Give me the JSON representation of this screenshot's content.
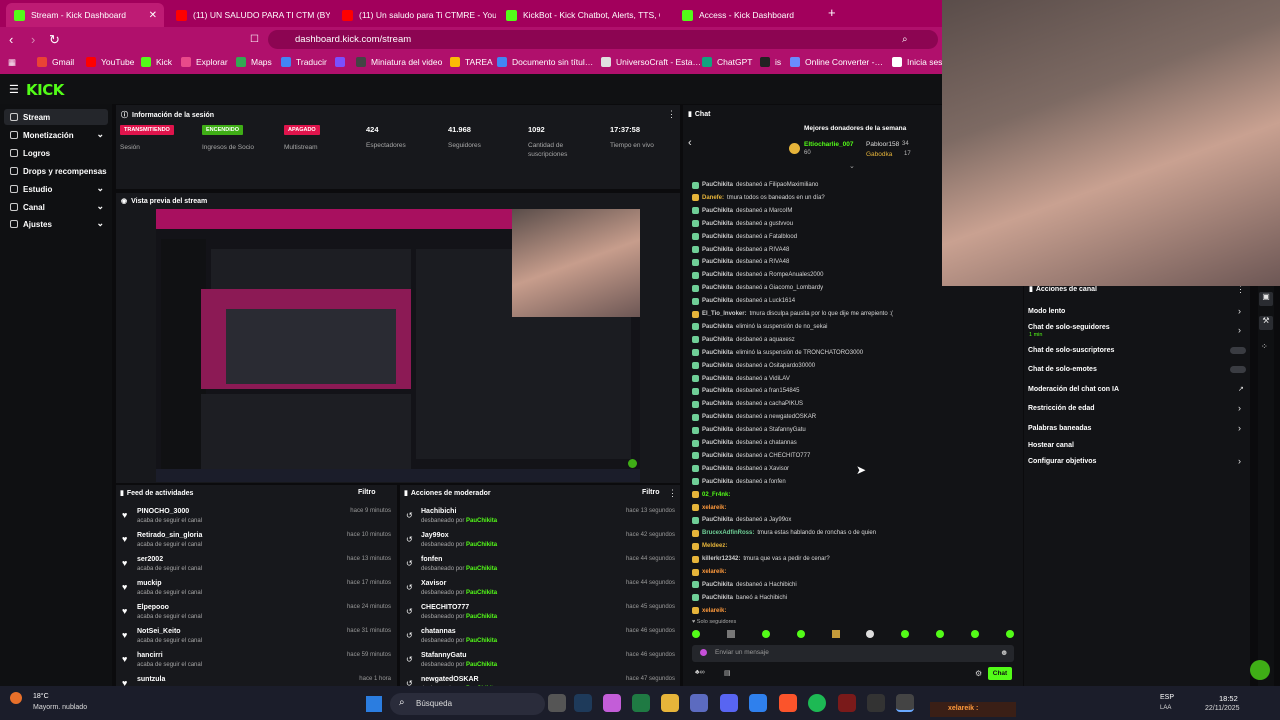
{
  "browser": {
    "tabs": [
      {
        "title": "Stream - Kick Dashboard",
        "icon": "kick-icon",
        "color": "#53fc18"
      },
      {
        "title": "(11) UN SALUDO PARA TI CTM (BY P…",
        "icon": "youtube-icon",
        "color": "#ff0000"
      },
      {
        "title": "(11) Un saludo para Ti CTMRE - YouT…",
        "icon": "youtube-icon",
        "color": "#ff0000"
      },
      {
        "title": "KickBot - Kick Chatbot, Alerts, TTS, C…",
        "icon": "kickbot-icon",
        "color": "#53fc18"
      },
      {
        "title": "Access - Kick Dashboard",
        "icon": "kick-icon",
        "color": "#53fc18"
      }
    ],
    "url": "dashboard.kick.com/stream",
    "bookmarks": [
      "Gmail",
      "YouTube",
      "Kick",
      "Explorar",
      "Maps",
      "Traducir",
      "",
      "Miniatura del video",
      "TAREA",
      "Documento sin títul…",
      "UniversoCraft - Esta…",
      "ChatGPT",
      "is",
      "Online Converter -…",
      "Inicia sesi"
    ]
  },
  "sidebar": {
    "items": [
      {
        "label": "Stream",
        "chev": ""
      },
      {
        "label": "Monetización",
        "chev": "⌄"
      },
      {
        "label": "Logros",
        "chev": ""
      },
      {
        "label": "Drops y recompensas",
        "chev": ""
      },
      {
        "label": "Estudio",
        "chev": "⌄"
      },
      {
        "label": "Canal",
        "chev": "⌄"
      },
      {
        "label": "Ajustes",
        "chev": "⌄"
      }
    ]
  },
  "session": {
    "title": "Información de la sesión",
    "stats": [
      {
        "badge": "TRANSMITIENDO",
        "badge_color": "#e0144c",
        "label": "Sesión"
      },
      {
        "badge": "ENCENDIDO",
        "badge_color": "#3fae16",
        "label": "Ingresos de Socio"
      },
      {
        "badge": "APAGADO",
        "badge_color": "#e0144c",
        "label": "Multistream"
      },
      {
        "value": "424",
        "label": "Espectadores"
      },
      {
        "value": "41.968",
        "label": "Seguidores"
      },
      {
        "value": "1092",
        "label": "Cantidad de suscripciones"
      },
      {
        "value": "17:37:58",
        "label": "Tiempo en vivo"
      }
    ]
  },
  "preview": {
    "title": "Vista previa del stream"
  },
  "activity": {
    "title": "Feed de actividades",
    "filter": "Filtro",
    "items": [
      {
        "name": "PINOCHO_3000",
        "sub": "acaba de seguir el canal",
        "time": "hace 9 minutos"
      },
      {
        "name": "Retirado_sin_gloria",
        "sub": "acaba de seguir el canal",
        "time": "hace 10 minutos"
      },
      {
        "name": "ser2002",
        "sub": "acaba de seguir el canal",
        "time": "hace 13 minutos"
      },
      {
        "name": "muckip",
        "sub": "acaba de seguir el canal",
        "time": "hace 17 minutos"
      },
      {
        "name": "Elpepooo",
        "sub": "acaba de seguir el canal",
        "time": "hace 24 minutos"
      },
      {
        "name": "NotSei_Keito",
        "sub": "acaba de seguir el canal",
        "time": "hace 31 minutos"
      },
      {
        "name": "hancirri",
        "sub": "acaba de seguir el canal",
        "time": "hace 59 minutos"
      },
      {
        "name": "suntzula",
        "sub": "",
        "time": "hace 1 hora"
      }
    ]
  },
  "modactions": {
    "title": "Acciones de moderador",
    "filter": "Filtro",
    "items": [
      {
        "name": "Hachibichi",
        "time": "hace 13 segundos"
      },
      {
        "name": "Jay99ox",
        "time": "hace 42 segundos"
      },
      {
        "name": "fonfen",
        "time": "hace 44 segundos"
      },
      {
        "name": "Xavisor",
        "time": "hace 44 segundos"
      },
      {
        "name": "CHECHITO777",
        "time": "hace 45 segundos"
      },
      {
        "name": "chatannas",
        "time": "hace 46 segundos"
      },
      {
        "name": "StafannyGatu",
        "time": "hace 46 segundos"
      },
      {
        "name": "newgatedOSKAR",
        "time": "hace 47 segundos"
      }
    ],
    "sub_prefix": "desbaneado por",
    "moderator": "PauChikita"
  },
  "chat": {
    "title": "Chat",
    "donors_title": "Mejores donadores de la semana",
    "donors": [
      {
        "name": "Eltiocharlie_007",
        "amount": "60"
      },
      {
        "name": "Pabloor158",
        "amount": "34"
      },
      {
        "name": "Gabodka",
        "amount": "17"
      }
    ],
    "lines": [
      {
        "user": "PauChikita",
        "text": "desbaneó a FilipaoMaximiliano"
      },
      {
        "user": "Danefe:",
        "text": "tmura todos os baneados en un día?"
      },
      {
        "user": "PauChikita",
        "text": "desbaneó a MarcoIM"
      },
      {
        "user": "PauChikita",
        "text": "desbaneó a gustvvou"
      },
      {
        "user": "PauChikita",
        "text": "desbaneó a Fatalblood"
      },
      {
        "user": "PauChikita",
        "text": "desbaneó a RIVA48"
      },
      {
        "user": "PauChikita",
        "text": "desbaneó a RIVA48"
      },
      {
        "user": "PauChikita",
        "text": "desbaneó a RompeAnuales2000"
      },
      {
        "user": "PauChikita",
        "text": "desbaneó a Giacomo_Lombardy"
      },
      {
        "user": "PauChikita",
        "text": "desbaneó a Luck1614"
      },
      {
        "user": "El_Tio_Invoker:",
        "text": "tmura disculpa pausita por lo que dije me arrepiento :("
      },
      {
        "user": "PauChikita",
        "text": "eliminó la suspensión de no_sekai"
      },
      {
        "user": "PauChikita",
        "text": "desbaneó a aquaxesz"
      },
      {
        "user": "PauChikita",
        "text": "eliminó la suspensión de TRONCHATORO3000"
      },
      {
        "user": "PauChikita",
        "text": "desbaneó a Ositapardo30000"
      },
      {
        "user": "PauChikita",
        "text": "desbaneó a VidiLAV"
      },
      {
        "user": "PauChikita",
        "text": "desbaneó a fran154845"
      },
      {
        "user": "PauChikita",
        "text": "desbaneó a cachaPIKUS"
      },
      {
        "user": "PauChikita",
        "text": "desbaneó a newgatedOSKAR"
      },
      {
        "user": "PauChikita",
        "text": "desbaneó a StafannyGatu"
      },
      {
        "user": "PauChikita",
        "text": "desbaneó a chatannas"
      },
      {
        "user": "PauChikita",
        "text": "desbaneó a CHECHITO777"
      },
      {
        "user": "PauChikita",
        "text": "desbaneó a Xavisor"
      },
      {
        "user": "PauChikita",
        "text": "desbaneó a fonfen"
      },
      {
        "user": "02_Fr4nk:",
        "text": ""
      },
      {
        "user": "xelareik:",
        "text": ""
      },
      {
        "user": "PauChikita",
        "text": "desbaneó a Jay99ox"
      },
      {
        "user": "BrucexAdfinRoss:",
        "text": "tmura estas hablando de ronchas o de quien"
      },
      {
        "user": "Meldeez:",
        "text": ""
      },
      {
        "user": "killerkr12342:",
        "text": "tmura       que vas a pedir de cenar?"
      },
      {
        "user": "xelareik:",
        "text": ""
      },
      {
        "user": "PauChikita",
        "text": "desbaneó a Hachibichi"
      },
      {
        "user": "PauChikita",
        "text": "baneó a Hachibichi"
      },
      {
        "user": "xelareik:",
        "text": ""
      }
    ],
    "followers_only": "Solo seguidores",
    "input_placeholder": "Enviar un mensaje",
    "send_label": "Chat"
  },
  "channel_actions": {
    "title": "Acciones de canal",
    "items": [
      {
        "label": "Modo lento",
        "control": "chevron"
      },
      {
        "label": "Chat de solo-seguidores",
        "sub": "1 min",
        "control": "chevron"
      },
      {
        "label": "Chat de solo-suscriptores",
        "control": "toggle"
      },
      {
        "label": "Chat de solo-emotes",
        "control": "toggle"
      },
      {
        "label": "Moderación del chat con IA",
        "control": "external"
      },
      {
        "label": "Restricción de edad",
        "control": "chevron"
      },
      {
        "label": "Palabras baneadas",
        "control": "chevron"
      },
      {
        "label": "Hostear canal",
        "control": "none"
      },
      {
        "label": "Configurar objetivos",
        "control": "chevron"
      }
    ]
  },
  "taskbar": {
    "weather_temp": "18°C",
    "weather_desc": "Mayorm. nublado",
    "search": "Búsqueda",
    "lang": "ESP",
    "lang_sub": "LAA",
    "time": "18:52",
    "date": "22/11/2025",
    "notification": "xelareik :"
  },
  "colors": {
    "kick_green": "#53fc18",
    "browser_pink": "#b0106c",
    "live_red": "#e0144c"
  }
}
